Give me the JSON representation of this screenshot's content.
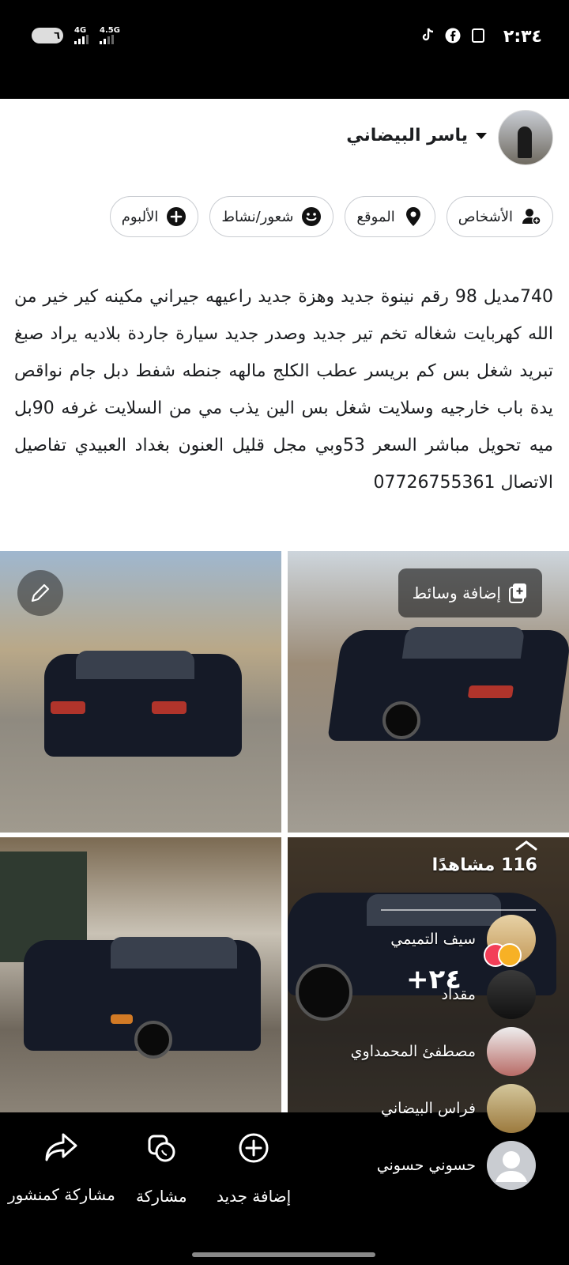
{
  "status_bar": {
    "time": "٢:٣٤",
    "battery": "٦",
    "network_1": "4G",
    "network_2": "4.5G"
  },
  "header": {
    "user_name": "ياسر البيضاني"
  },
  "chips": [
    {
      "label": "الأشخاص",
      "icon": "people-icon"
    },
    {
      "label": "الموقع",
      "icon": "location-pin-icon"
    },
    {
      "label": "شعور/نشاط",
      "icon": "smiley-icon"
    },
    {
      "label": "الألبوم",
      "icon": "plus-circle-icon"
    }
  ],
  "post_text": "740مديل 98 رقم نينوة جديد وهزة جديد راعيهه جيراني مكينه كير خير من الله كهربايت شغاله تخم تير جديد وصدر جديد سيارة جاردة بلاديه يراد صبغ تبريد شغل بس كم بريسر عطب الكلج مالهه جنطه شفط دبل جام نواقص يدة باب خارجيه وسلايت شغل بس الين يذب مي من السلايت غرفه 90بل ميه تحويل مباشر السعر 53وبي مجل قليل العنون بغداد العبيدي تفاصيل الاتصال 07726755361",
  "media": {
    "add_media_label": "إضافة وسائط",
    "more_count": "+٢٤",
    "views": "116 مشاهدًا"
  },
  "likers": [
    {
      "name": "سيف التميمي",
      "reaction": "love"
    },
    {
      "name": "مقداد",
      "reaction": "care"
    },
    {
      "name": "مصطفئ المحمداوي",
      "reaction": "none"
    },
    {
      "name": "فراس البيضاني",
      "reaction": "none"
    },
    {
      "name": "حسوني حسوني",
      "reaction": "none"
    }
  ],
  "bottom_actions": {
    "add_new": "إضافة جديد",
    "share": "مشاركة",
    "share_as_post": "مشاركة كمنشور"
  },
  "colors": {
    "love": "#f33e58",
    "care": "#f7b125"
  }
}
